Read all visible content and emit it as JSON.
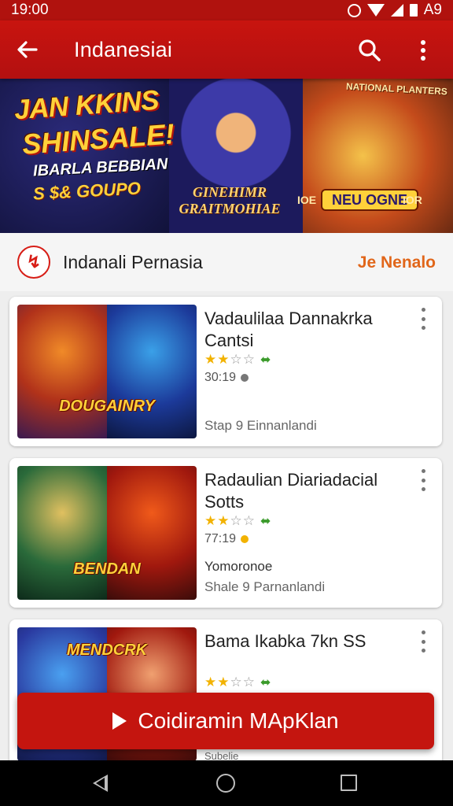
{
  "status_bar": {
    "time": "19:00",
    "right_text": "A9"
  },
  "app_bar": {
    "title": "Indanesiai"
  },
  "banner": {
    "headline_1": "JAN KKINS",
    "headline_2": "SHINSALE!",
    "sub_1": "IBARLA BEBBIAN",
    "sub_2": "S $& GOUPO",
    "center_text": "GINEHIMR GRAITMOHIAE",
    "right_top_text": "NATIONAL PLANTERS",
    "badge_pre": "IOE",
    "badge_label": "NEU OGNE",
    "badge_post": "IOR"
  },
  "section": {
    "logo_glyph": "↯",
    "title": "Indanali Pernasia",
    "link": "Je Nenalo"
  },
  "cards": [
    {
      "title": "Vadaulilaa Dannakrka Cantsi",
      "stars": "★★",
      "stars_off": "☆☆",
      "badge": "⬌",
      "price": "30:19",
      "extra": "",
      "meta": "Stap 9  Einnanlandi",
      "thumb_label": "DOUGAINRY"
    },
    {
      "title": "Radaulian Diariadacial Sotts",
      "stars": "★★",
      "stars_off": "☆☆",
      "badge": "⬌",
      "price": "77:19",
      "extra": "Yomoronoe",
      "meta": "Shale 9  Parnanlandi",
      "thumb_label": "BENDAN"
    },
    {
      "title": "Bama Ikabka 7kn SS",
      "stars": "★★",
      "stars_off": "☆☆",
      "badge": "⬌",
      "price": "",
      "extra": "",
      "meta": "Subelie",
      "thumb_label": "MENDCRK"
    }
  ],
  "cta": {
    "label": "Coidiramin MApKlan"
  },
  "colors": {
    "primary": "#c4150f",
    "accent": "#e1661a",
    "star": "#f2b200"
  }
}
